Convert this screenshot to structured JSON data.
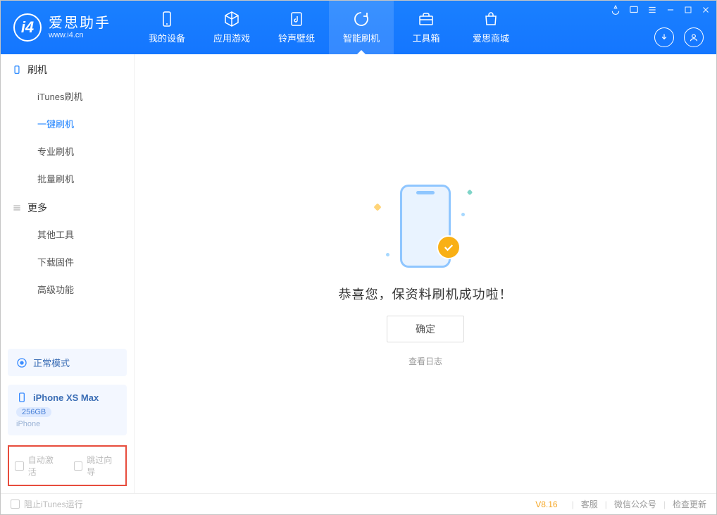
{
  "brand": {
    "name": "爱思助手",
    "url": "www.i4.cn"
  },
  "tabs": {
    "t0": "我的设备",
    "t1": "应用游戏",
    "t2": "铃声壁纸",
    "t3": "智能刷机",
    "t4": "工具箱",
    "t5": "爱思商城"
  },
  "sidebar": {
    "group1": "刷机",
    "items1": {
      "i0": "iTunes刷机",
      "i1": "一键刷机",
      "i2": "专业刷机",
      "i3": "批量刷机"
    },
    "group2": "更多",
    "items2": {
      "i0": "其他工具",
      "i1": "下载固件",
      "i2": "高级功能"
    },
    "status": "正常模式",
    "device": {
      "name": "iPhone XS Max",
      "capacity": "256GB",
      "type": "iPhone"
    },
    "opts": {
      "auto": "自动激活",
      "skip": "跳过向导"
    }
  },
  "main": {
    "success": "恭喜您，保资料刷机成功啦！",
    "confirm": "确定",
    "log": "查看日志"
  },
  "footer": {
    "block": "阻止iTunes运行",
    "version": "V8.16",
    "links": {
      "l0": "客服",
      "l1": "微信公众号",
      "l2": "检查更新"
    }
  }
}
